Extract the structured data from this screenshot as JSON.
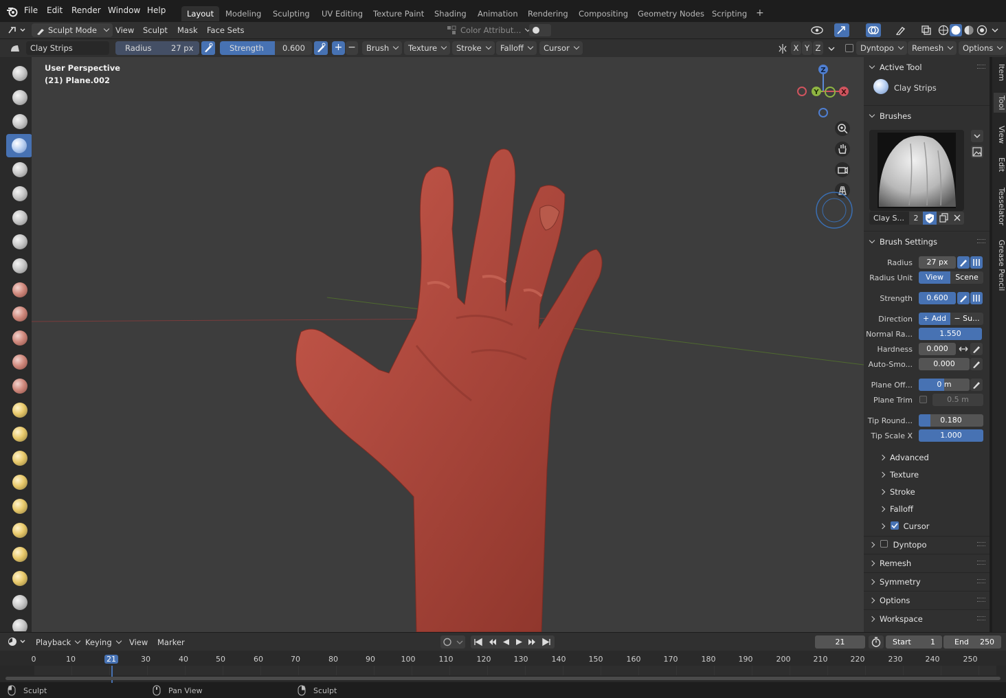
{
  "menu": {
    "file": "File",
    "edit": "Edit",
    "render": "Render",
    "window": "Window",
    "help": "Help"
  },
  "workspaces": [
    "Layout",
    "Modeling",
    "Sculpting",
    "UV Editing",
    "Texture Paint",
    "Shading",
    "Animation",
    "Rendering",
    "Compositing",
    "Geometry Nodes",
    "Scripting"
  ],
  "workspace_add": "+",
  "header1": {
    "mode": "Sculpt Mode",
    "view": "View",
    "sculpt": "Sculpt",
    "mask": "Mask",
    "face_sets": "Face Sets",
    "color_attr": "Color Attribut..."
  },
  "header2": {
    "brush_name": "Clay Strips",
    "radius_label": "Radius",
    "radius_value": "27 px",
    "strength_label": "Strength",
    "strength_value": "0.600",
    "plus": "+",
    "minus": "−",
    "brush": "Brush",
    "texture": "Texture",
    "stroke": "Stroke",
    "falloff": "Falloff",
    "cursor": "Cursor",
    "x": "X",
    "y": "Y",
    "z": "Z",
    "dyntopo": "Dyntopo",
    "remesh": "Remesh",
    "options": "Options"
  },
  "viewport": {
    "perspective": "User Perspective",
    "object": "(21) Plane.002"
  },
  "gizmo": {
    "z": "Z",
    "y": "Y",
    "x": "X"
  },
  "npanel": {
    "tabs": [
      "Item",
      "Tool",
      "View",
      "Edit",
      "Tesselator",
      "Grease Pencil"
    ],
    "active_tool_title": "Active Tool",
    "active_tool_name": "Clay Strips",
    "brushes_title": "Brushes",
    "brush_slot_name": "Clay S...",
    "brush_users": "2",
    "brush_settings_title": "Brush Settings",
    "radius_label": "Radius",
    "radius_value": "27 px",
    "radius_unit_label": "Radius Unit",
    "radius_unit_view": "View",
    "radius_unit_scene": "Scene",
    "strength_label": "Strength",
    "strength_value": "0.600",
    "direction_label": "Direction",
    "direction_add": "+ Add",
    "direction_sub": "− Su...",
    "normal_radius_label": "Normal Ra...",
    "normal_radius_value": "1.550",
    "hardness_label": "Hardness",
    "hardness_value": "0.000",
    "auto_smooth_label": "Auto-Smo...",
    "auto_smooth_value": "0.000",
    "plane_offset_label": "Plane Off...",
    "plane_offset_value": "0 m",
    "plane_trim_label": "Plane Trim",
    "plane_trim_value": "0.5 m",
    "tip_roundness_label": "Tip Round...",
    "tip_roundness_value": "0.180",
    "tip_scale_x_label": "Tip Scale X",
    "tip_scale_x_value": "1.000",
    "subsections": [
      "Advanced",
      "Texture",
      "Stroke",
      "Falloff",
      "Cursor"
    ],
    "sections": [
      "Dyntopo",
      "Remesh",
      "Symmetry",
      "Options",
      "Workspace"
    ]
  },
  "timeline": {
    "playback": "Playback",
    "keying": "Keying",
    "view": "View",
    "marker": "Marker",
    "current_frame": "21",
    "start_label": "Start",
    "start_value": "1",
    "end_label": "End",
    "end_value": "250",
    "ticks": [
      "0",
      "10",
      "21",
      "30",
      "40",
      "50",
      "60",
      "70",
      "80",
      "90",
      "100",
      "110",
      "120",
      "130",
      "140",
      "150",
      "160",
      "170",
      "180",
      "190",
      "200",
      "210",
      "220",
      "230",
      "240",
      "250"
    ]
  },
  "status": {
    "left": "Sculpt",
    "middle": "Pan View",
    "right": "Sculpt"
  },
  "colors": {
    "accent": "#4772b3",
    "panel": "#303030",
    "viewport": "#3d3d3d",
    "skin": "#b24a3e"
  }
}
